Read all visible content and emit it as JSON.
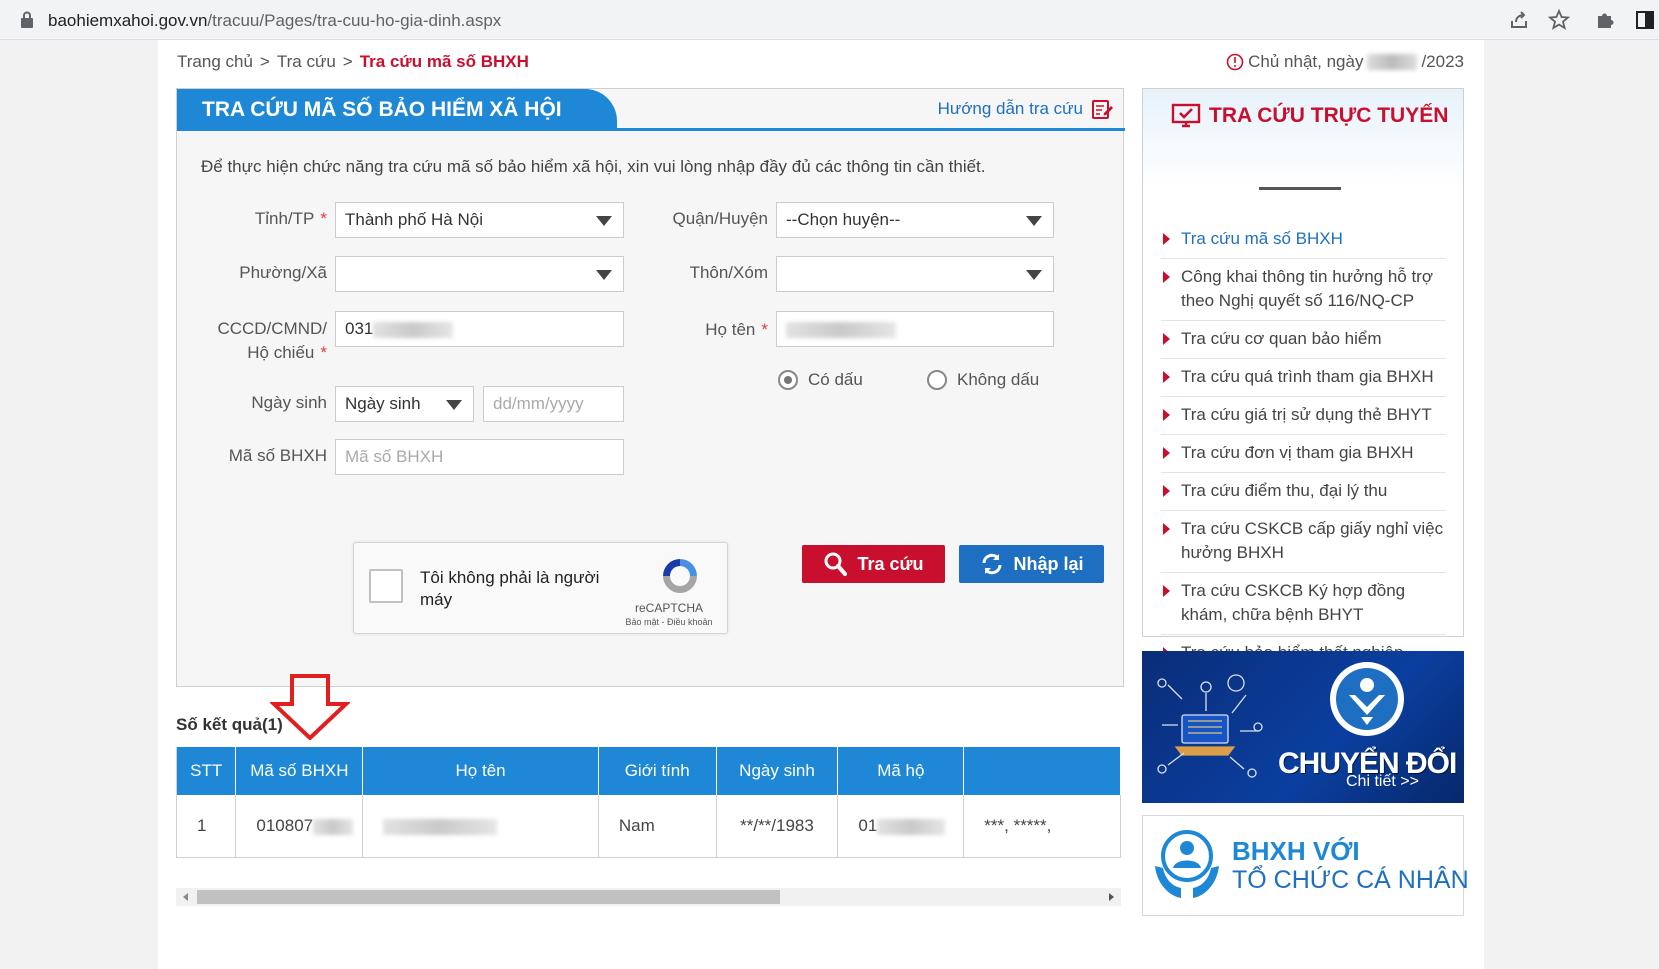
{
  "browser": {
    "domain": "baohiemxahoi.gov.vn",
    "path": "/tracuu/Pages/tra-cuu-ho-gia-dinh.aspx"
  },
  "breadcrumb": {
    "home": "Trang chủ",
    "section": "Tra cứu",
    "current": "Tra cứu mã số BHXH",
    "separator": ">"
  },
  "date": {
    "prefix": "Chủ nhật, ngày",
    "suffix": "/2023"
  },
  "form": {
    "title": "TRA CỨU MÃ SỐ BẢO HIỂM XÃ HỘI",
    "guide_link": "Hướng dẫn tra cứu",
    "intro": "Để thực hiện chức năng tra cứu mã số bảo hiểm xã hội, xin vui lòng nhập đầy đủ các thông tin cần thiết.",
    "province_label": "Tỉnh/TP",
    "province_value": "Thành phố Hà Nội",
    "district_label": "Quận/Huyện",
    "district_value": "--Chọn huyện--",
    "ward_label": "Phường/Xã",
    "ward_value": "",
    "village_label": "Thôn/Xóm",
    "village_value": "",
    "id_label_1": "CCCD/CMND/",
    "id_label_2": "Hộ chiếu",
    "id_value": "031",
    "name_label": "Họ tên",
    "name_value": "",
    "required_mark": "*",
    "radio_accent": "Có dấu",
    "radio_no_accent": "Không dấu",
    "dob_label": "Ngày sinh",
    "dob_type_value": "Ngày sinh",
    "dob_placeholder": "dd/mm/yyyy",
    "ssn_label": "Mã số BHXH",
    "ssn_placeholder": "Mã số BHXH",
    "captcha_text": "Tôi không phải là người máy",
    "captcha_brand": "reCAPTCHA",
    "captcha_links": "Bảo mật - Điều khoản",
    "search_button": "Tra cứu",
    "reset_button": "Nhập lại"
  },
  "results": {
    "label": "Số kết quả(1)",
    "columns": [
      "STT",
      "Mã số BHXH",
      "Họ tên",
      "Giới tính",
      "Ngày sinh",
      "Mã hộ",
      ""
    ],
    "rows": [
      [
        "1",
        "010807",
        "",
        "Nam",
        "**/**/1983",
        "01",
        "***, *****,"
      ]
    ]
  },
  "sidebar": {
    "title": "TRA CỨU TRỰC TUYẾN",
    "items": [
      "Tra cứu mã số BHXH",
      "Công khai thông tin hưởng hỗ trợ theo Nghị quyết số 116/NQ-CP",
      "Tra cứu cơ quan bảo hiểm",
      "Tra cứu quá trình tham gia BHXH",
      "Tra cứu giá trị sử dụng thẻ BHYT",
      "Tra cứu đơn vị tham gia BHXH",
      "Tra cứu điểm thu, đại lý thu",
      "Tra cứu CSKCB cấp giấy nghỉ việc hưởng BHXH",
      "Tra cứu CSKCB Ký hợp đồng khám, chữa bệnh BHYT",
      "Tra cứu bảo hiểm thất nghiệp"
    ],
    "active_index": 0
  },
  "banners": {
    "digital_title": "CHUYỂN ĐỔI SỐ",
    "digital_more": "Chi tiết >>",
    "org_line1": "BHXH VỚI",
    "org_line2": "TỔ CHỨC CÁ NHÂN"
  },
  "colors": {
    "primary_blue": "#1e88d7",
    "dark_blue": "#1e6fc1",
    "accent_red": "#c8102e"
  }
}
